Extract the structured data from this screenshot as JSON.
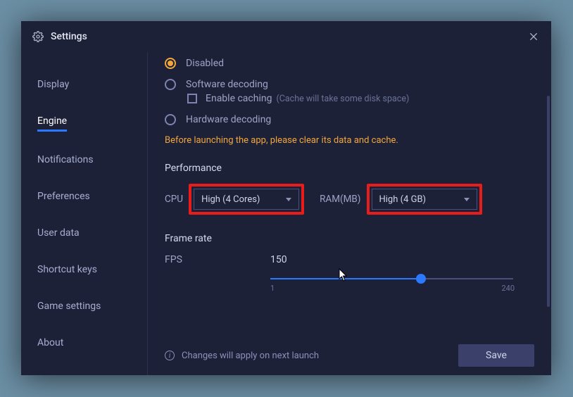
{
  "title": "Settings",
  "sidebar": {
    "items": [
      {
        "label": "Display"
      },
      {
        "label": "Engine"
      },
      {
        "label": "Notifications"
      },
      {
        "label": "Preferences"
      },
      {
        "label": "User data"
      },
      {
        "label": "Shortcut keys"
      },
      {
        "label": "Game settings"
      },
      {
        "label": "About"
      }
    ],
    "active_index": 1
  },
  "decoding": {
    "options": {
      "disabled": "Disabled",
      "software": "Software decoding",
      "hardware": "Hardware decoding"
    },
    "selected": "disabled",
    "enable_caching_label": "Enable caching",
    "enable_caching_hint": "(Cache will take some disk space)"
  },
  "warning_text": "Before launching the app, please clear its data and cache.",
  "performance": {
    "title": "Performance",
    "cpu_label": "CPU",
    "cpu_value": "High (4 Cores)",
    "ram_label": "RAM(MB)",
    "ram_value": "High (4 GB)"
  },
  "frame_rate": {
    "title": "Frame rate",
    "fps_label": "FPS",
    "fps_value": "150",
    "min": "1",
    "max": "240"
  },
  "footer": {
    "note": "Changes will apply on next launch",
    "save_label": "Save"
  }
}
